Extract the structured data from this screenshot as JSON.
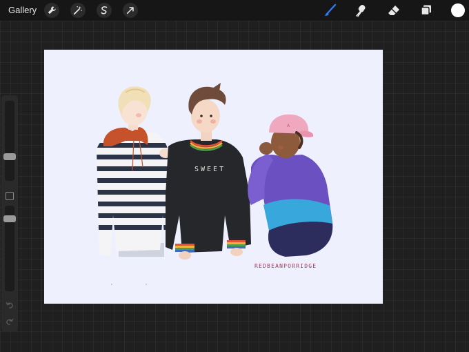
{
  "toolbar": {
    "gallery_label": "Gallery",
    "left_tools": [
      "wrench-icon",
      "magic-wand-icon",
      "selection-icon",
      "transform-arrow-icon"
    ],
    "right_tools": [
      "brush-icon",
      "smudge-icon",
      "eraser-icon",
      "layers-icon"
    ],
    "active_tool": "brush-icon",
    "active_color": "#ffffff",
    "accent_color": "#2f7bf5"
  },
  "sidebar": {
    "brush_size_level": 0.3,
    "opacity_level": 0.85,
    "undo_icon": "undo-icon",
    "redo_icon": "redo-icon"
  },
  "artwork": {
    "sweater_text": "SWEET",
    "signature": "REDBEANPORRIDGE",
    "background_color": "#eef0fe"
  }
}
